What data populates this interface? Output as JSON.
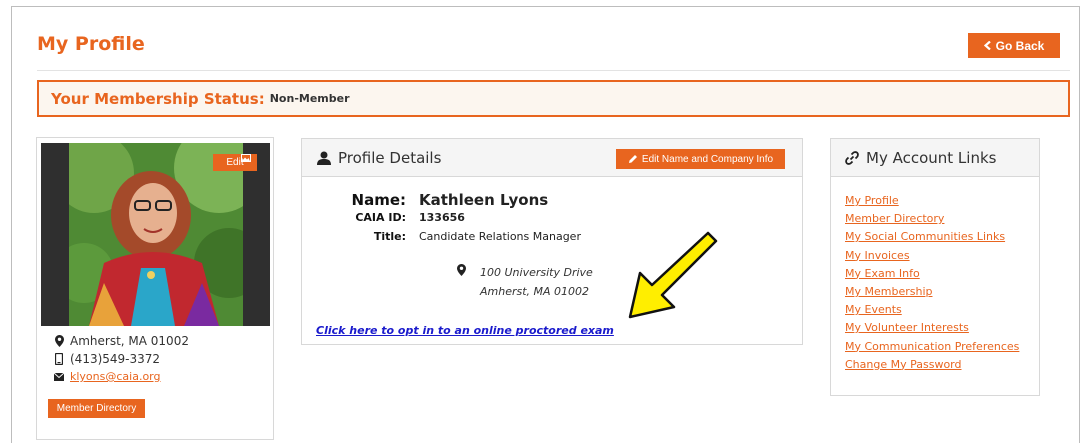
{
  "page": {
    "title": "My Profile",
    "go_back_label": "Go Back"
  },
  "membership": {
    "label": "Your Membership Status:",
    "value": "Non-Member"
  },
  "left_card": {
    "edit_label": "Edit",
    "location": "Amherst, MA 01002",
    "phone": "(413)549-3372",
    "email": "klyons@caia.org",
    "member_directory_label": "Member Directory"
  },
  "profile_details": {
    "heading": "Profile Details",
    "edit_button_label": "Edit Name and Company Info",
    "name_label": "Name:",
    "name_value": "Kathleen Lyons",
    "caia_id_label": "CAIA ID:",
    "caia_id_value": "133656",
    "title_label": "Title:",
    "title_value": "Candidate Relations Manager",
    "address_line1": "100 University Drive",
    "address_line2": "Amherst, MA 01002",
    "optin_link": "Click here to opt in to an online proctored exam"
  },
  "account_links": {
    "heading": "My Account Links",
    "items": [
      "My Profile",
      "Member Directory",
      "My Social Communities Links",
      "My Invoices",
      "My Exam Info",
      "My Membership",
      "My Events",
      "My Volunteer Interests",
      "My Communication Preferences",
      "Change My Password"
    ]
  },
  "colors": {
    "accent": "#e8651f",
    "link_blue": "#1a1acc",
    "arrow_yellow": "#ffee00"
  }
}
